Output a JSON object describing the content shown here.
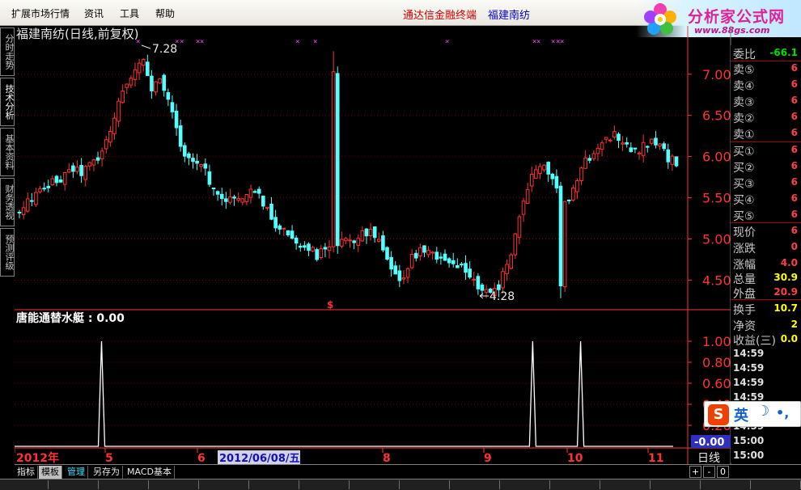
{
  "menu": {
    "items": [
      "扩展市场行情",
      "资讯",
      "工具",
      "帮助"
    ],
    "title_left": "通达信金融终端",
    "title_right": "福建南纺"
  },
  "logo": {
    "main": "分析家公式网",
    "url": "www.88gs.com"
  },
  "left_tabs": [
    "分时走势",
    "技术分析",
    "基本资料",
    "财务透视",
    "预测评级"
  ],
  "main_chart": {
    "title": "福建南纺(日线,前复权)",
    "y_ticks": [
      "7.00",
      "6.50",
      "6.00",
      "5.50",
      "5.00",
      "4.50"
    ],
    "high_label": "7.28",
    "low_label": "4.28",
    "dollar_marker": "$"
  },
  "indicator": {
    "title": "唐能通替水艇 : 0.00",
    "y_ticks": [
      "1.00",
      "0.80",
      "0.60",
      "0.40",
      "0.20"
    ],
    "current_value": "-0.00"
  },
  "x_axis": {
    "labels": [
      "2012年",
      "5",
      "6",
      "2012/06/08/五",
      "8",
      "9",
      "10",
      "11"
    ],
    "period": "日线"
  },
  "chart_data": [
    {
      "type": "candlestick",
      "title": "福建南纺(日线,前复权)",
      "ylim": [
        4.2,
        7.4
      ],
      "y_ticks": [
        7.0,
        6.5,
        6.0,
        5.5,
        5.0,
        4.5
      ],
      "x_month_labels": [
        "5",
        "6",
        "8",
        "9",
        "10",
        "11"
      ],
      "max_price": 7.28,
      "min_price": 4.28,
      "close_trend": [
        5.3,
        5.45,
        5.55,
        5.6,
        5.7,
        5.75,
        5.85,
        5.8,
        5.9,
        5.95,
        6.2,
        6.55,
        6.85,
        7.05,
        7.2,
        6.8,
        6.9,
        6.7,
        6.3,
        6.0,
        5.9,
        5.95,
        5.6,
        5.5,
        5.5,
        5.45,
        5.55,
        5.6,
        5.4,
        5.2,
        5.1,
        5.05,
        4.95,
        4.9,
        4.8,
        4.85,
        4.9,
        4.95,
        5.0,
        5.05,
        5.1,
        4.95,
        4.7,
        4.5,
        4.6,
        4.8,
        4.9,
        4.85,
        4.75,
        4.7,
        4.65,
        4.6,
        4.5,
        4.35,
        4.3,
        4.5,
        4.8,
        5.2,
        5.6,
        5.9,
        5.85,
        5.7,
        5.4,
        5.5,
        5.8,
        6.0,
        6.1,
        6.2,
        6.3,
        6.15,
        6.05,
        6.1,
        6.2,
        6.15,
        6.0,
        5.9
      ]
    },
    {
      "type": "line",
      "title": "唐能通替水艇",
      "ylim": [
        0,
        1.0
      ],
      "y_ticks": [
        1.0,
        0.8,
        0.6,
        0.4,
        0.2
      ],
      "signal_days": [
        12,
        75,
        82
      ],
      "signal_value": 1.0,
      "current": 0.0
    }
  ],
  "right_panel": {
    "rows": [
      {
        "label": "委比",
        "value": "-66.1",
        "color": "#00e000"
      },
      {
        "label": "卖⑤",
        "value": "6",
        "color": "#ff4040"
      },
      {
        "label": "卖④",
        "value": "6",
        "color": "#ff4040"
      },
      {
        "label": "卖③",
        "value": "6",
        "color": "#ff4040"
      },
      {
        "label": "卖②",
        "value": "6",
        "color": "#ff4040"
      },
      {
        "label": "卖①",
        "value": "6",
        "color": "#ff4040"
      },
      {
        "label": "买①",
        "value": "6",
        "color": "#ff4040"
      },
      {
        "label": "买②",
        "value": "6",
        "color": "#ff4040"
      },
      {
        "label": "买③",
        "value": "6",
        "color": "#ff4040"
      },
      {
        "label": "买④",
        "value": "6",
        "color": "#ff4040"
      },
      {
        "label": "买⑤",
        "value": "6",
        "color": "#ff4040"
      },
      {
        "label": "现价",
        "value": "6",
        "color": "#ff4040"
      },
      {
        "label": "涨跌",
        "value": "0",
        "color": "#ff4040"
      },
      {
        "label": "涨幅",
        "value": "4.0",
        "color": "#ff4040"
      },
      {
        "label": "总量",
        "value": "30.9",
        "color": "#ffff00"
      },
      {
        "label": "外盘",
        "value": "20.9",
        "color": "#ff4040"
      },
      {
        "label": "换手",
        "value": "10.7",
        "color": "#ffff00"
      },
      {
        "label": "净资",
        "value": "2",
        "color": "#ffff00"
      },
      {
        "label": "收益(三)",
        "value": "0.0",
        "color": "#ffff00"
      }
    ],
    "times": [
      "14:59",
      "14:59",
      "14:59",
      "14:59",
      "14:59",
      "14:59",
      "15:00",
      "15:00"
    ]
  },
  "bottom_tabs": [
    "指标",
    "模板",
    "管理",
    "另存为",
    "MACD基本"
  ],
  "controls": [
    "+",
    "-",
    "0"
  ],
  "ime": {
    "lang": "英",
    "moon": "☽",
    "punc": "•,"
  },
  "colors": {
    "up": "#ff3232",
    "down": "#54ffff",
    "axis": "#ff3232",
    "grid": "#8b0000"
  }
}
